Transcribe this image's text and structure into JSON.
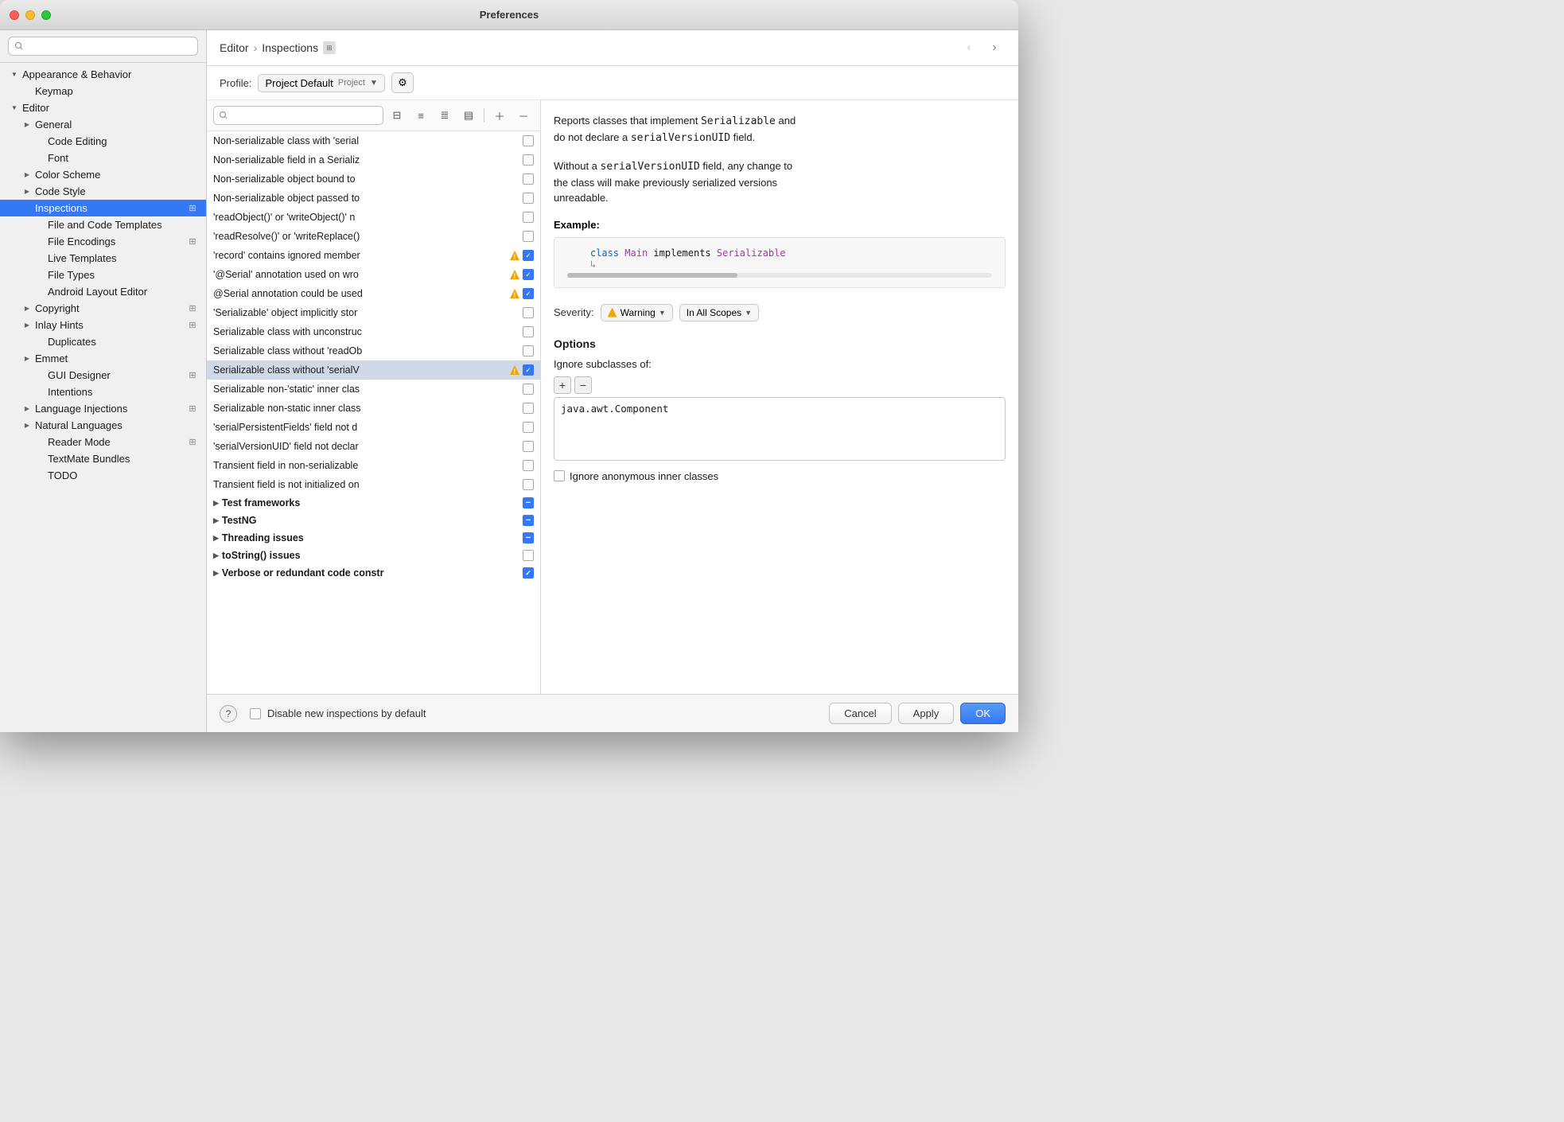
{
  "window": {
    "title": "Preferences"
  },
  "sidebar": {
    "search_placeholder": "",
    "items": [
      {
        "id": "appearance",
        "label": "Appearance & Behavior",
        "indent": 0,
        "type": "group-expanded",
        "badge": false
      },
      {
        "id": "keymap",
        "label": "Keymap",
        "indent": 1,
        "type": "leaf",
        "badge": false
      },
      {
        "id": "editor",
        "label": "Editor",
        "indent": 0,
        "type": "group-expanded",
        "badge": false
      },
      {
        "id": "general",
        "label": "General",
        "indent": 1,
        "type": "group-collapsed",
        "badge": false
      },
      {
        "id": "code-editing",
        "label": "Code Editing",
        "indent": 2,
        "type": "leaf",
        "badge": false
      },
      {
        "id": "font",
        "label": "Font",
        "indent": 2,
        "type": "leaf",
        "badge": false
      },
      {
        "id": "color-scheme",
        "label": "Color Scheme",
        "indent": 1,
        "type": "group-collapsed",
        "badge": false
      },
      {
        "id": "code-style",
        "label": "Code Style",
        "indent": 1,
        "type": "group-collapsed",
        "badge": false
      },
      {
        "id": "inspections",
        "label": "Inspections",
        "indent": 1,
        "type": "leaf",
        "badge": true,
        "selected": true
      },
      {
        "id": "file-code-templates",
        "label": "File and Code Templates",
        "indent": 2,
        "type": "leaf",
        "badge": false
      },
      {
        "id": "file-encodings",
        "label": "File Encodings",
        "indent": 2,
        "type": "leaf",
        "badge": true
      },
      {
        "id": "live-templates",
        "label": "Live Templates",
        "indent": 2,
        "type": "leaf",
        "badge": false
      },
      {
        "id": "file-types",
        "label": "File Types",
        "indent": 2,
        "type": "leaf",
        "badge": false
      },
      {
        "id": "android-layout-editor",
        "label": "Android Layout Editor",
        "indent": 2,
        "type": "leaf",
        "badge": false
      },
      {
        "id": "copyright",
        "label": "Copyright",
        "indent": 1,
        "type": "group-collapsed",
        "badge": true
      },
      {
        "id": "inlay-hints",
        "label": "Inlay Hints",
        "indent": 1,
        "type": "group-collapsed",
        "badge": true
      },
      {
        "id": "duplicates",
        "label": "Duplicates",
        "indent": 2,
        "type": "leaf",
        "badge": false
      },
      {
        "id": "emmet",
        "label": "Emmet",
        "indent": 1,
        "type": "group-collapsed",
        "badge": false
      },
      {
        "id": "gui-designer",
        "label": "GUI Designer",
        "indent": 2,
        "type": "leaf",
        "badge": true
      },
      {
        "id": "intentions",
        "label": "Intentions",
        "indent": 2,
        "type": "leaf",
        "badge": false
      },
      {
        "id": "language-injections",
        "label": "Language Injections",
        "indent": 1,
        "type": "group-collapsed",
        "badge": true
      },
      {
        "id": "natural-languages",
        "label": "Natural Languages",
        "indent": 1,
        "type": "group-collapsed",
        "badge": false
      },
      {
        "id": "reader-mode",
        "label": "Reader Mode",
        "indent": 2,
        "type": "leaf",
        "badge": true
      },
      {
        "id": "textmate-bundles",
        "label": "TextMate Bundles",
        "indent": 2,
        "type": "leaf",
        "badge": false
      },
      {
        "id": "todo",
        "label": "TODO",
        "indent": 2,
        "type": "leaf",
        "badge": false
      }
    ]
  },
  "header": {
    "breadcrumb_editor": "Editor",
    "breadcrumb_inspections": "Inspections",
    "nav_back_disabled": true,
    "nav_forward_disabled": false
  },
  "profile": {
    "label": "Profile:",
    "value": "Project Default",
    "tag": "Project"
  },
  "inspection_toolbar": {
    "search_placeholder": ""
  },
  "inspection_rows": [
    {
      "label": "Non-serializable class with 'serial",
      "warning": false,
      "checked": false
    },
    {
      "label": "Non-serializable field in a Serializ",
      "warning": false,
      "checked": false
    },
    {
      "label": "Non-serializable object bound to",
      "warning": false,
      "checked": false
    },
    {
      "label": "Non-serializable object passed to",
      "warning": false,
      "checked": false
    },
    {
      "label": "'readObject()' or 'writeObject()' n",
      "warning": false,
      "checked": false
    },
    {
      "label": "'readResolve()' or 'writeReplace()",
      "warning": false,
      "checked": false
    },
    {
      "label": "'record' contains ignored member",
      "warning": true,
      "checked": true
    },
    {
      "label": "'@Serial' annotation used on wro",
      "warning": true,
      "checked": true
    },
    {
      "label": "@Serial annotation could be used",
      "warning": true,
      "checked": true
    },
    {
      "label": "'Serializable' object implicitly stor",
      "warning": false,
      "checked": false
    },
    {
      "label": "Serializable class with unconstruc",
      "warning": false,
      "checked": false
    },
    {
      "label": "Serializable class without 'readOb",
      "warning": false,
      "checked": false
    },
    {
      "label": "Serializable class without 'serialV",
      "warning": true,
      "checked": true,
      "selected": true
    },
    {
      "label": "Serializable non-'static' inner clas",
      "warning": false,
      "checked": false
    },
    {
      "label": "Serializable non-static inner class",
      "warning": false,
      "checked": false
    },
    {
      "label": "'serialPersistentFields' field not d",
      "warning": false,
      "checked": false
    },
    {
      "label": "'serialVersionUID' field not declar",
      "warning": false,
      "checked": false
    },
    {
      "label": "Transient field in non-serializable",
      "warning": false,
      "checked": false
    },
    {
      "label": "Transient field is not initialized on",
      "warning": false,
      "checked": false
    }
  ],
  "group_rows": [
    {
      "label": "Test frameworks",
      "checked": "partial"
    },
    {
      "label": "TestNG",
      "checked": "partial"
    },
    {
      "label": "Threading issues",
      "checked": "partial"
    },
    {
      "label": "toString() issues",
      "checked": false
    },
    {
      "label": "Verbose or redundant code constr",
      "checked": true
    }
  ],
  "description": {
    "text1": "Reports classes that implement ",
    "code1": "Serializable",
    "text2": " and\ndo not declare a ",
    "code2": "serialVersionUID",
    "text3": " field.",
    "text4": "Without a ",
    "code3": "serialVersionUID",
    "text5": " field, any change to\nthe class will make previously serialized versions\nunreadable.",
    "example_label": "Example:",
    "code_example": "    class Main implements Serializable"
  },
  "severity": {
    "label": "Severity:",
    "value": "Warning",
    "scope_value": "In All Scopes"
  },
  "options": {
    "title": "Options",
    "ignore_subclasses_label": "Ignore subclasses of:",
    "java_awt_component": "java.awt.Component",
    "ignore_anonymous_label": "Ignore anonymous inner classes"
  },
  "footer": {
    "disable_label": "Disable new inspections by default",
    "cancel_label": "Cancel",
    "apply_label": "Apply",
    "ok_label": "OK"
  }
}
